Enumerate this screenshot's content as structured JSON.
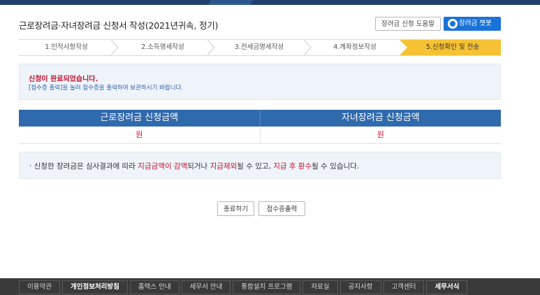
{
  "page": {
    "title": "근로장려금·자녀장려금 신청서 작성(2021년귀속, 정기)",
    "help_button": "장려금 신청 도움말",
    "chat_button": "장려금 챗봇"
  },
  "steps": [
    {
      "label": "1.인적사항작성",
      "active": false
    },
    {
      "label": "2.소득명세작성",
      "active": false
    },
    {
      "label": "3.전세금명세작성",
      "active": false
    },
    {
      "label": "4.계좌정보작성",
      "active": false
    },
    {
      "label": "5.신청확인 및 전송",
      "active": true
    }
  ],
  "notice": {
    "line1": "신청이 완료되었습니다.",
    "line2": "[접수증 출력]을 눌러 접수증을 출력하여 보관하시기 바랍니다."
  },
  "amounts": {
    "headers": [
      "근로장려금 신청금액",
      "자녀장려금 신청금액"
    ],
    "values": [
      "원",
      "원"
    ]
  },
  "info": {
    "prefix": "· 신청한 장려금은 심사결과에 따라 ",
    "red1": "지급금액이 감액",
    "mid1": "되거나 ",
    "red2": "지급제외",
    "mid2": "될 수 있고, ",
    "red3": "지급 후 환수",
    "suffix": "될 수 있습니다."
  },
  "actions": {
    "close": "종료하기",
    "print_receipt": "접수증출력"
  },
  "footer": {
    "links": [
      {
        "label": "이용약관",
        "bold": false
      },
      {
        "label": "개인정보처리방침",
        "bold": true
      },
      {
        "label": "홈택스 안내",
        "bold": false
      },
      {
        "label": "세무서 안내",
        "bold": false
      },
      {
        "label": "통합설치 프로그램",
        "bold": false
      },
      {
        "label": "자료실",
        "bold": false
      },
      {
        "label": "공지사항",
        "bold": false
      },
      {
        "label": "고객센터",
        "bold": false
      },
      {
        "label": "세무서식",
        "bold": true
      }
    ]
  },
  "colors": {
    "accent_blue": "#2f6aad",
    "active_step": "#f6c233",
    "alert_red": "#c8102e"
  }
}
